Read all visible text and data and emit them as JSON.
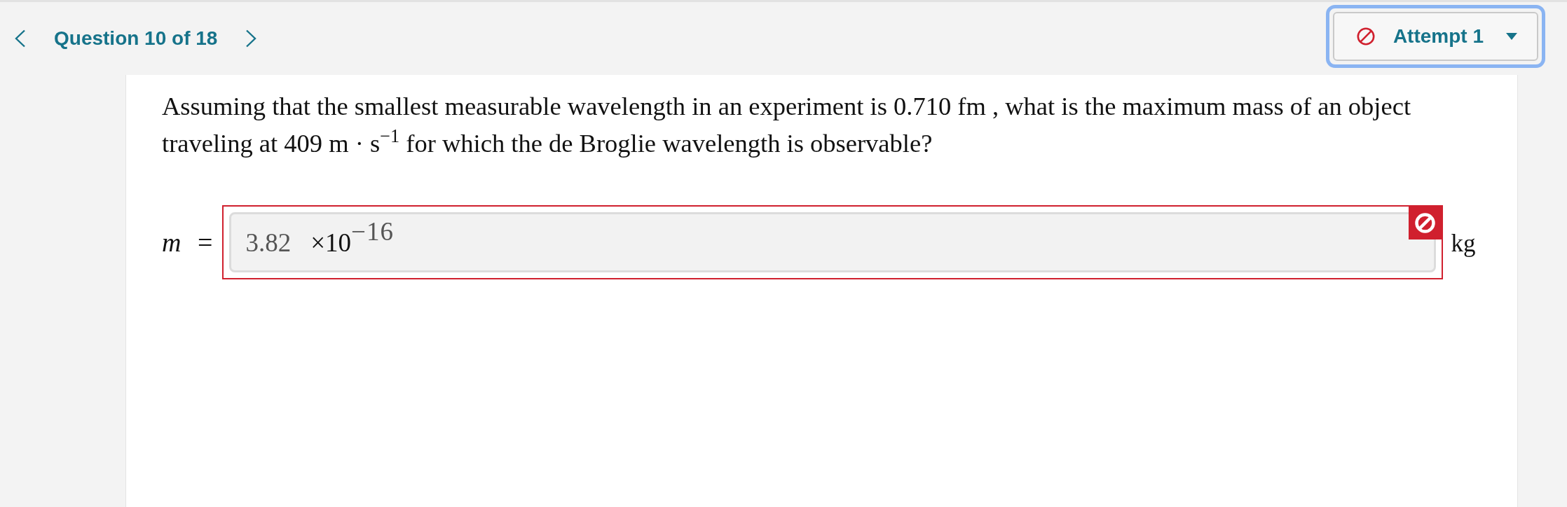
{
  "navigation": {
    "question_label": "Question 10 of 18"
  },
  "attempt_menu": {
    "label": "Attempt 1",
    "focused": true,
    "correct": false
  },
  "question": {
    "text": "Assuming that the smallest measurable wavelength in an experiment is 0.710 fm , what is the maximum mass of an object traveling at 409 m · s$^{−1}$ for which the de Broglie wavelength is observable?"
  },
  "answer": {
    "variable": "*m* =",
    "value": "3.82",
    "multiplier": "×10",
    "exponent": "−16",
    "unit": "kg",
    "correct": false
  }
}
